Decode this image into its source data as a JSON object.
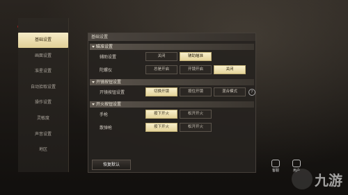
{
  "header": {
    "title": "设置"
  },
  "sidebar": {
    "items": [
      {
        "label": "基础设置",
        "active": true
      },
      {
        "label": "画面设置"
      },
      {
        "label": "准星设置"
      },
      {
        "label": "自动拾取设置"
      },
      {
        "label": "操作设置"
      },
      {
        "label": "灵敏度"
      },
      {
        "label": "声音设置"
      },
      {
        "label": "地区"
      }
    ]
  },
  "panel": {
    "title": "基础设置",
    "sections": [
      {
        "title": "瞄准设置",
        "rows": [
          {
            "label": "辅助设置",
            "options": [
              "关闭",
              "辅助瞄准"
            ],
            "selected": 1
          },
          {
            "label": "陀螺仪",
            "options": [
              "总是开启",
              "开镜开启",
              "关闭"
            ],
            "selected": 2
          }
        ]
      },
      {
        "title": "开镜按钮设置",
        "rows": [
          {
            "label": "开镜按钮设置",
            "options": [
              "切换开镜",
              "按住开镜",
              "混合模式"
            ],
            "selected": 0
          }
        ]
      },
      {
        "title": "开火按钮设置",
        "rows": [
          {
            "label": "手枪",
            "options": [
              "按下开火",
              "松开开火"
            ],
            "selected": 0
          },
          {
            "label": "散弹枪",
            "options": [
              "按下开火",
              "松开开火"
            ],
            "selected": 0
          }
        ]
      }
    ],
    "help_glyph": "?"
  },
  "footer": {
    "reset_label": "恢复默认",
    "tools": [
      {
        "label": "客服",
        "icon": "headset-icon"
      },
      {
        "label": "用户",
        "icon": "user-icon"
      }
    ]
  },
  "watermark": {
    "text": "九游"
  }
}
